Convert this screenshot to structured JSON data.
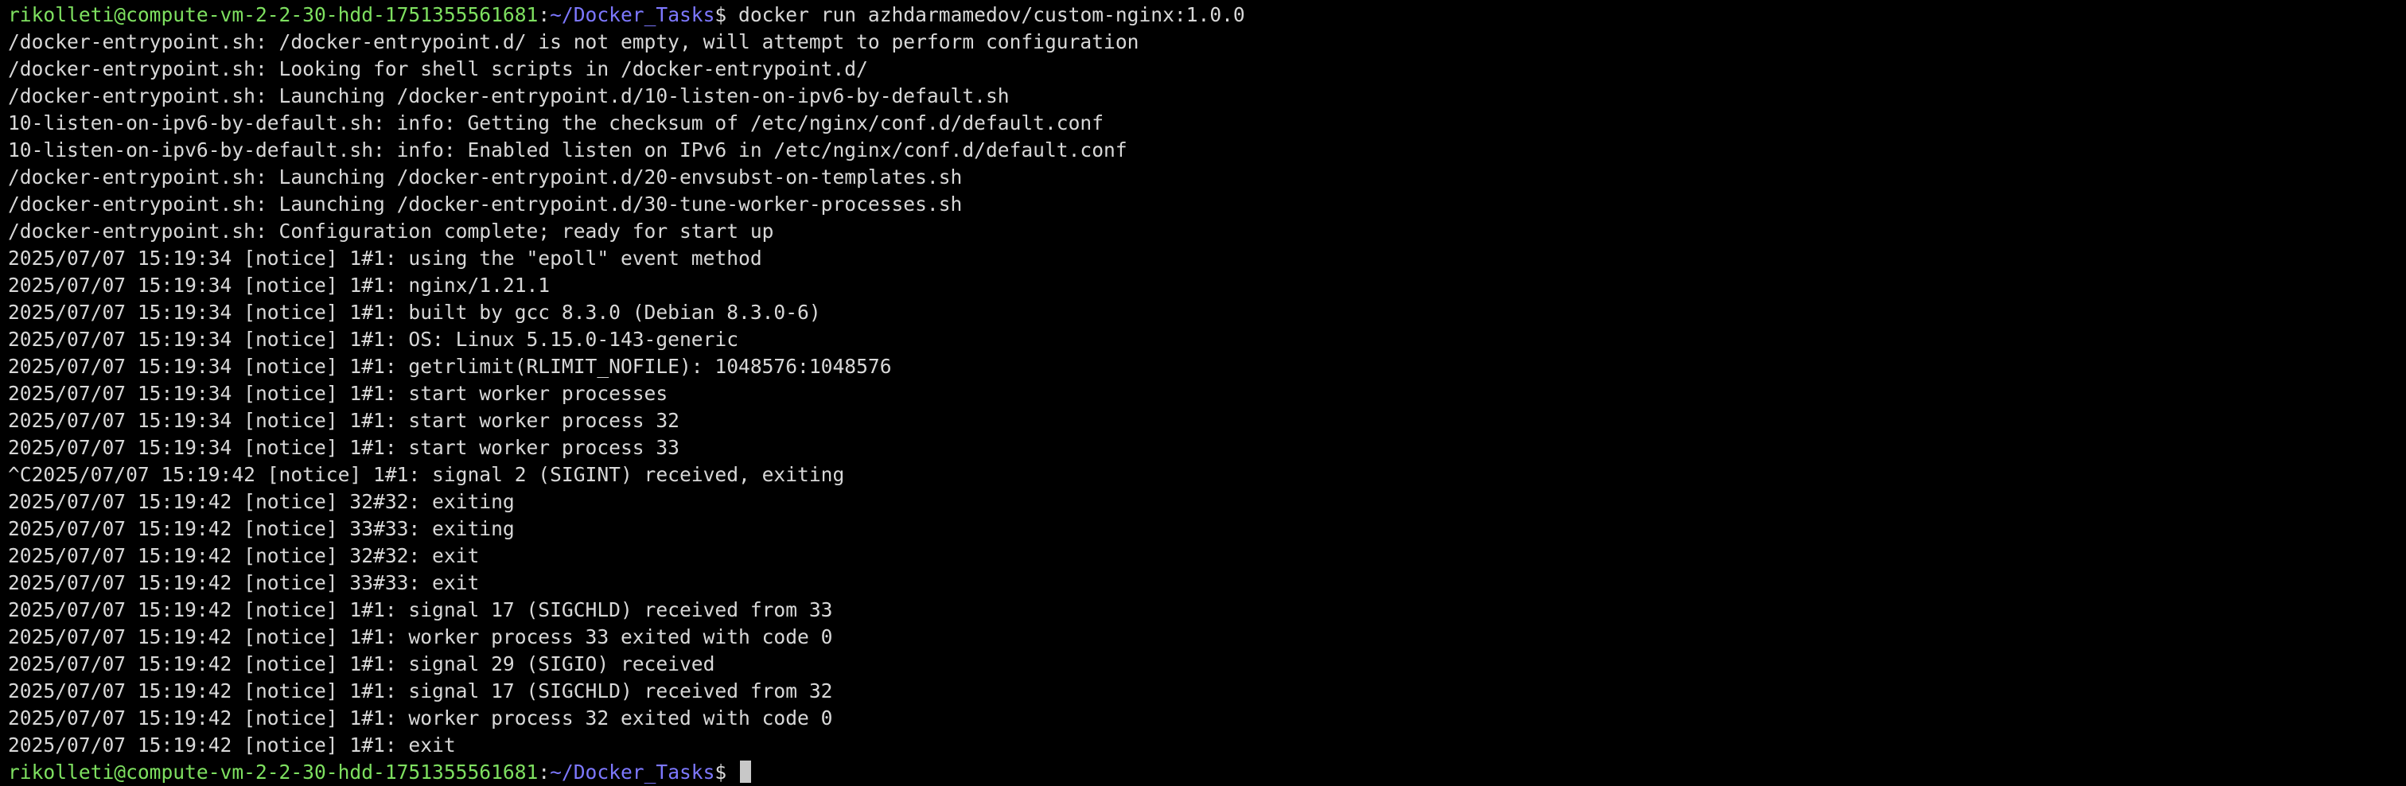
{
  "colors": {
    "background": "#000000",
    "foreground": "#d8d8d8",
    "prompt_user": "#7ee060",
    "prompt_path": "#7d78ff",
    "cursor": "#c8c8c8"
  },
  "prompt": {
    "user_host": "rikolleti@compute-vm-2-2-30-hdd-1751355561681",
    "separator": ":",
    "path": "~/Docker_Tasks",
    "symbol": "$ "
  },
  "command": "docker run azhdarmamedov/custom-nginx:1.0.0",
  "output_lines": [
    "/docker-entrypoint.sh: /docker-entrypoint.d/ is not empty, will attempt to perform configuration",
    "/docker-entrypoint.sh: Looking for shell scripts in /docker-entrypoint.d/",
    "/docker-entrypoint.sh: Launching /docker-entrypoint.d/10-listen-on-ipv6-by-default.sh",
    "10-listen-on-ipv6-by-default.sh: info: Getting the checksum of /etc/nginx/conf.d/default.conf",
    "10-listen-on-ipv6-by-default.sh: info: Enabled listen on IPv6 in /etc/nginx/conf.d/default.conf",
    "/docker-entrypoint.sh: Launching /docker-entrypoint.d/20-envsubst-on-templates.sh",
    "/docker-entrypoint.sh: Launching /docker-entrypoint.d/30-tune-worker-processes.sh",
    "/docker-entrypoint.sh: Configuration complete; ready for start up",
    "2025/07/07 15:19:34 [notice] 1#1: using the \"epoll\" event method",
    "2025/07/07 15:19:34 [notice] 1#1: nginx/1.21.1",
    "2025/07/07 15:19:34 [notice] 1#1: built by gcc 8.3.0 (Debian 8.3.0-6)",
    "2025/07/07 15:19:34 [notice] 1#1: OS: Linux 5.15.0-143-generic",
    "2025/07/07 15:19:34 [notice] 1#1: getrlimit(RLIMIT_NOFILE): 1048576:1048576",
    "2025/07/07 15:19:34 [notice] 1#1: start worker processes",
    "2025/07/07 15:19:34 [notice] 1#1: start worker process 32",
    "2025/07/07 15:19:34 [notice] 1#1: start worker process 33",
    "^C2025/07/07 15:19:42 [notice] 1#1: signal 2 (SIGINT) received, exiting",
    "2025/07/07 15:19:42 [notice] 32#32: exiting",
    "2025/07/07 15:19:42 [notice] 33#33: exiting",
    "2025/07/07 15:19:42 [notice] 32#32: exit",
    "2025/07/07 15:19:42 [notice] 33#33: exit",
    "2025/07/07 15:19:42 [notice] 1#1: signal 17 (SIGCHLD) received from 33",
    "2025/07/07 15:19:42 [notice] 1#1: worker process 33 exited with code 0",
    "2025/07/07 15:19:42 [notice] 1#1: signal 29 (SIGIO) received",
    "2025/07/07 15:19:42 [notice] 1#1: signal 17 (SIGCHLD) received from 32",
    "2025/07/07 15:19:42 [notice] 1#1: worker process 32 exited with code 0",
    "2025/07/07 15:19:42 [notice] 1#1: exit"
  ],
  "final_prompt": {
    "user_host": "rikolleti@compute-vm-2-2-30-hdd-1751355561681",
    "separator": ":",
    "path": "~/Docker_Tasks",
    "symbol": "$ "
  }
}
